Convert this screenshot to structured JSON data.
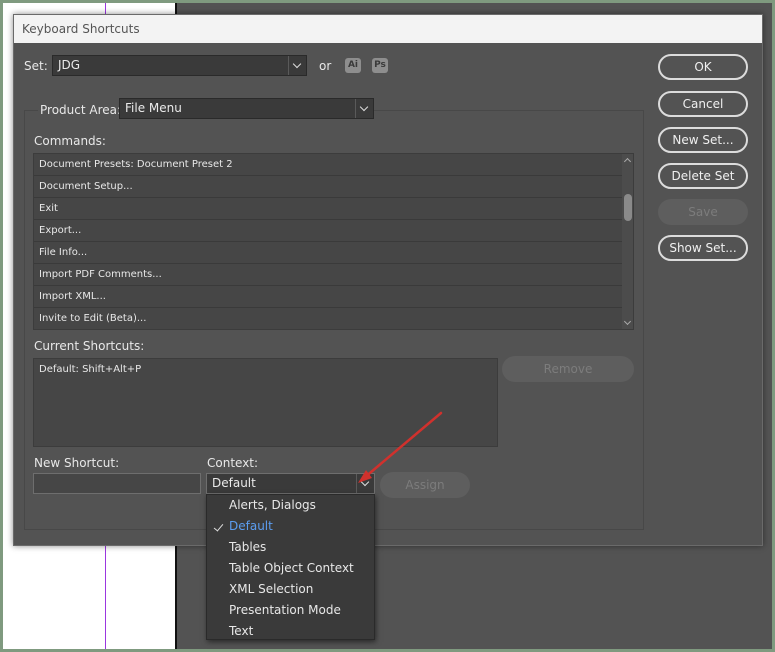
{
  "dialog": {
    "title": "Keyboard Shortcuts"
  },
  "set": {
    "label": "Set:",
    "value": "JDG",
    "or_label": "or",
    "app_icons": [
      "Ai",
      "Ps"
    ]
  },
  "product_area": {
    "label": "Product Area:",
    "value": "File Menu"
  },
  "commands": {
    "label": "Commands:",
    "items": [
      "Document Presets: Document Preset 2",
      "Document Setup...",
      "Exit",
      "Export...",
      "File Info...",
      "Import PDF Comments...",
      "Import XML...",
      "Invite to Edit (Beta)..."
    ]
  },
  "current_shortcuts": {
    "label": "Current Shortcuts:",
    "items": [
      "Default: Shift+Alt+P"
    ]
  },
  "new_shortcut": {
    "label": "New Shortcut:",
    "value": ""
  },
  "context": {
    "label": "Context:",
    "value": "Default",
    "options": [
      {
        "label": "Alerts, Dialogs",
        "checked": false
      },
      {
        "label": "Default",
        "checked": true
      },
      {
        "label": "Tables",
        "checked": false
      },
      {
        "label": "Table Object Context",
        "checked": false
      },
      {
        "label": "XML Selection",
        "checked": false
      },
      {
        "label": "Presentation Mode",
        "checked": false
      },
      {
        "label": "Text",
        "checked": false
      }
    ]
  },
  "buttons": {
    "ok": "OK",
    "cancel": "Cancel",
    "new_set": "New Set...",
    "delete_set": "Delete Set",
    "save": "Save",
    "show_set": "Show Set...",
    "remove": "Remove",
    "assign": "Assign"
  },
  "colors": {
    "selected_option": "#5b9df0",
    "annotation_arrow": "#d0312d"
  }
}
